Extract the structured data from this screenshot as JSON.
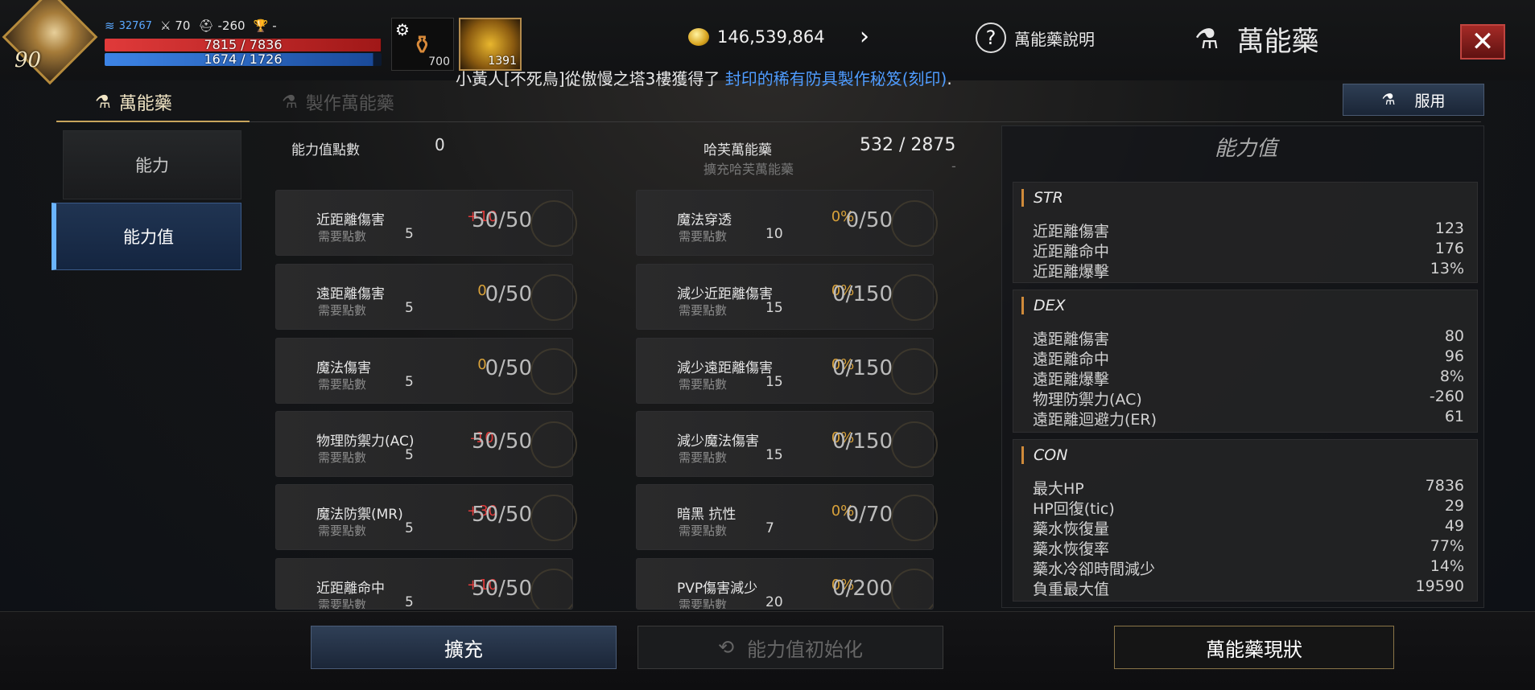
{
  "header": {
    "level": "90",
    "exp_value": "32767",
    "stat_a": "70",
    "stat_b": "-260",
    "stat_c": "-",
    "hp": "7815 / 7836",
    "hp_fraction": 0.997,
    "mp": "1674 / 1726",
    "mp_fraction": 0.97,
    "slot1_count": "700",
    "slot2_count": "1391",
    "gold": "146,539,864",
    "help_label": "萬能藥說明",
    "title": "萬能藥",
    "notice_text": "小黃人[不死鳥]從傲慢之塔3樓獲得了",
    "notice_highlight": "封印的稀有防具製作秘笈(刻印)",
    "notice_end": "."
  },
  "tabs": [
    "萬能藥",
    "製作萬能藥"
  ],
  "use_button": "服用",
  "sidebar": [
    "能力",
    "能力值"
  ],
  "summary": {
    "points_label": "能力值點數",
    "points_value": "0",
    "hayan_label": "哈芙萬能藥",
    "hayan_value": "532 / 2875",
    "expand_label": "擴充哈芙萬能藥",
    "expand_value": "-"
  },
  "left_cards": [
    {
      "name": "近距離傷害",
      "req_label": "需要點數",
      "req": "5",
      "bonus": "+10",
      "progress": "50/50"
    },
    {
      "name": "遠距離傷害",
      "req_label": "需要點數",
      "req": "5",
      "bonus": "0",
      "progress": "0/50"
    },
    {
      "name": "魔法傷害",
      "req_label": "需要點數",
      "req": "5",
      "bonus": "0",
      "progress": "0/50"
    },
    {
      "name": "物理防禦力(AC)",
      "req_label": "需要點數",
      "req": "5",
      "bonus": "-10",
      "progress": "50/50"
    },
    {
      "name": "魔法防禦(MR)",
      "req_label": "需要點數",
      "req": "5",
      "bonus": "+30",
      "progress": "50/50"
    },
    {
      "name": "近距離命中",
      "req_label": "需要點數",
      "req": "5",
      "bonus": "+10",
      "progress": "50/50"
    }
  ],
  "right_cards": [
    {
      "name": "魔法穿透",
      "req_label": "需要點數",
      "req": "10",
      "bonus": "0%",
      "progress": "0/50"
    },
    {
      "name": "減少近距離傷害",
      "req_label": "需要點數",
      "req": "15",
      "bonus": "0%",
      "progress": "0/150"
    },
    {
      "name": "減少遠距離傷害",
      "req_label": "需要點數",
      "req": "15",
      "bonus": "0%",
      "progress": "0/150"
    },
    {
      "name": "減少魔法傷害",
      "req_label": "需要點數",
      "req": "15",
      "bonus": "0%",
      "progress": "0/150"
    },
    {
      "name": "暗黑 抗性",
      "req_label": "需要點數",
      "req": "7",
      "bonus": "0%",
      "progress": "0/70"
    },
    {
      "name": "PVP傷害減少",
      "req_label": "需要點數",
      "req": "20",
      "bonus": "0%",
      "progress": "0/200"
    }
  ],
  "stats_panel": {
    "title": "能力值",
    "sections": [
      {
        "name": "STR",
        "rows": [
          {
            "label": "近距離傷害",
            "value": "123"
          },
          {
            "label": "近距離命中",
            "value": "176"
          },
          {
            "label": "近距離爆擊",
            "value": "13%"
          }
        ]
      },
      {
        "name": "DEX",
        "rows": [
          {
            "label": "遠距離傷害",
            "value": "80"
          },
          {
            "label": "遠距離命中",
            "value": "96"
          },
          {
            "label": "遠距離爆擊",
            "value": "8%"
          },
          {
            "label": "物理防禦力(AC)",
            "value": "-260"
          },
          {
            "label": "遠距離迴避力(ER)",
            "value": "61"
          }
        ]
      },
      {
        "name": "CON",
        "rows": [
          {
            "label": "最大HP",
            "value": "7836"
          },
          {
            "label": "HP回復(tic)",
            "value": "29"
          },
          {
            "label": "藥水恢復量",
            "value": "49"
          },
          {
            "label": "藥水恢復率",
            "value": "77%"
          },
          {
            "label": "藥水冷卻時間減少",
            "value": "14%"
          },
          {
            "label": "負重最大值",
            "value": "19590"
          }
        ]
      }
    ]
  },
  "bottom": {
    "expand": "擴充",
    "reset": "能力值初始化",
    "status": "萬能藥現狀"
  },
  "colors": {
    "bonus_positive": "#e03a3a",
    "bonus_zero": "#d9a23a",
    "accent_blue": "#4f9cff",
    "hp_red": "#e03a3a",
    "mp_blue": "#2f72d4"
  }
}
